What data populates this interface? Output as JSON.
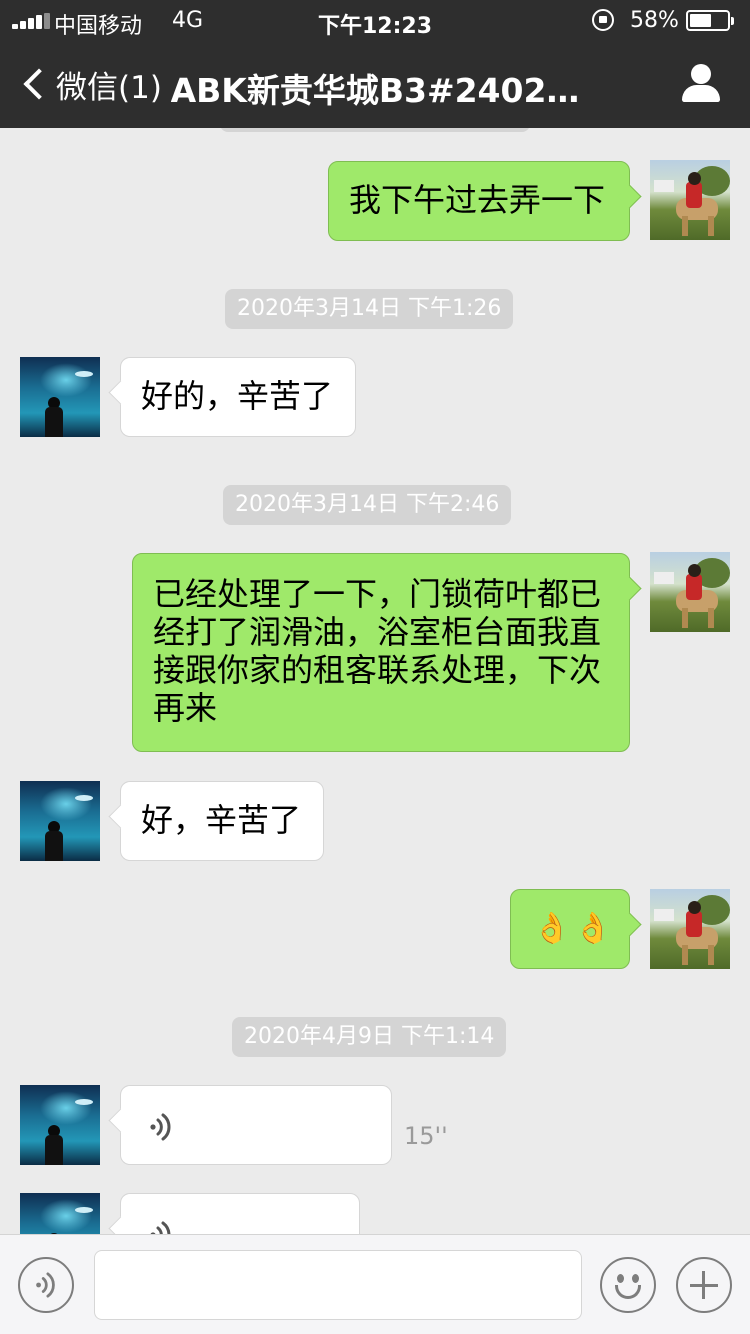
{
  "status_bar": {
    "carrier": "中国移动",
    "network": "4G",
    "time": "下午12:23",
    "battery_percent_label": "58%",
    "battery_level": 0.58
  },
  "nav": {
    "back_label": "微信(1)",
    "title": "ABK新贵华城B3#2402…",
    "profile_icon": "person-icon"
  },
  "messages": [
    {
      "side": "right",
      "type": "text",
      "text": "我下午过去弄一下"
    },
    {
      "type": "timestamp",
      "text": "2020年3月14日 下午1:26"
    },
    {
      "side": "left",
      "type": "text",
      "text": "好的，辛苦了"
    },
    {
      "type": "timestamp",
      "text": "2020年3月14日 下午2:46"
    },
    {
      "side": "right",
      "type": "text",
      "lines": [
        "已经处理了一下，门锁荷叶都已",
        "经打了润滑油，浴室柜台面我直",
        "接跟你家的租客联系处理，下次",
        "再来"
      ]
    },
    {
      "side": "left",
      "type": "text",
      "text": "好，辛苦了"
    },
    {
      "side": "right",
      "type": "emoji",
      "emojis": [
        "👌",
        "👌"
      ]
    },
    {
      "type": "timestamp",
      "text": "2020年4月9日 下午1:14"
    },
    {
      "side": "left",
      "type": "voice",
      "duration": "15''"
    },
    {
      "side": "left",
      "type": "voice",
      "duration": ""
    }
  ],
  "input_bar": {
    "icons": [
      "voice-mode-icon",
      "emoji-icon",
      "plus-icon"
    ]
  },
  "colors": {
    "nav_bg": "#2e2e2e",
    "chat_bg": "#ebebeb",
    "bubble_sent": "#9fe96a",
    "bubble_received": "#ffffff",
    "timestamp_bg": "#d4d4d4"
  }
}
